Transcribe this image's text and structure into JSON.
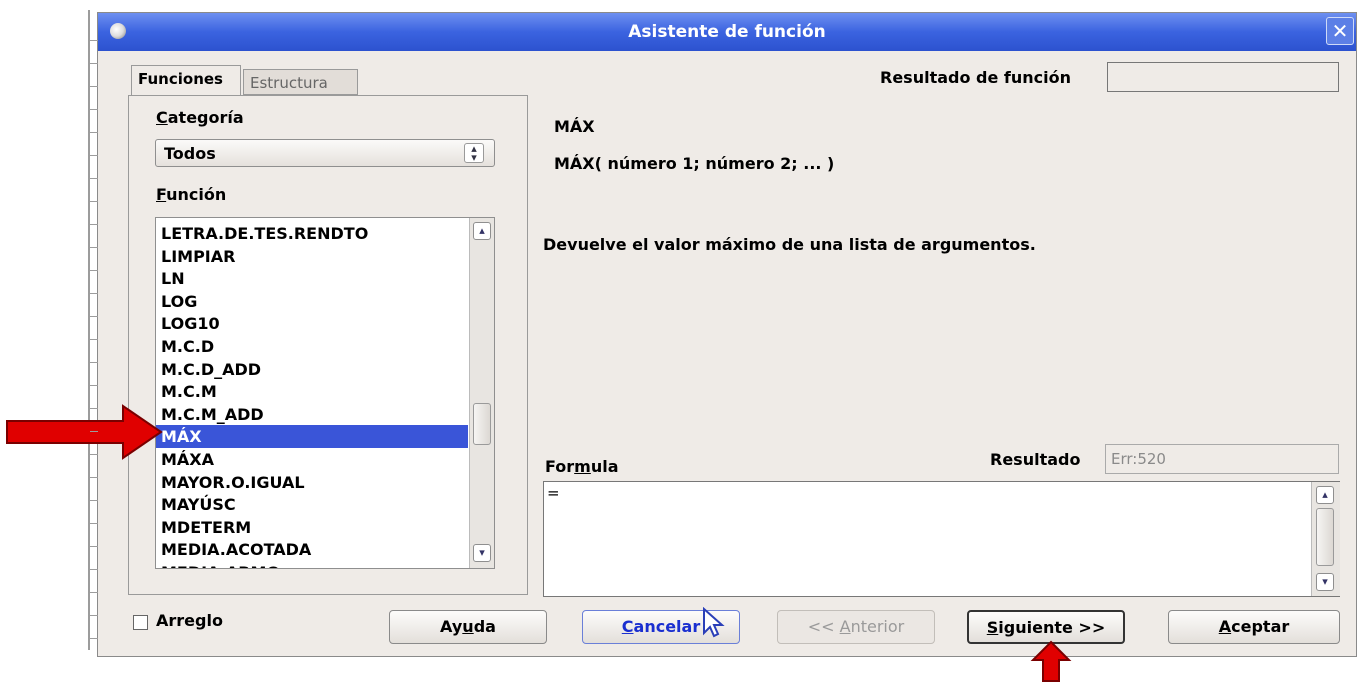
{
  "dialog": {
    "title": "Asistente de función",
    "close_glyph": "✕"
  },
  "tabs": {
    "funciones": "Funciones",
    "estructura": "Estructura"
  },
  "left": {
    "categoria_label": "Categoría",
    "categoria_value": "Todos",
    "funcion_label": "Función",
    "functions": [
      "LETRA.DE.TES.RENDTO",
      "LIMPIAR",
      "LN",
      "LOG",
      "LOG10",
      "M.C.D",
      "M.C.D_ADD",
      "M.C.M",
      "M.C.M_ADD",
      "MÁX",
      "MÁXA",
      "MAYOR.O.IGUAL",
      "MAYÚSC",
      "MDETERM",
      "MEDIA.ACOTADA",
      "MEDIA.ARMO"
    ],
    "selected_index": 9,
    "arreglo_label": "Arreglo",
    "arreglo_checked": false
  },
  "right": {
    "resultado_funcion_label": "Resultado de función",
    "resultado_funcion_value": "",
    "func_name": "MÁX",
    "func_syntax": "MÁX( número 1; número 2; ...  )",
    "func_description": "Devuelve el valor máximo de una lista de argumentos.",
    "formula_label": "Formula",
    "resultado_label": "Resultado",
    "resultado_value": "Err:520",
    "formula_text": "="
  },
  "buttons": {
    "ayuda": "Ayuda",
    "cancelar": "Cancelar",
    "anterior": "<< Anterior",
    "siguiente": "Siguiente >>",
    "aceptar": "Aceptar"
  },
  "icons": {
    "up": "▲",
    "down": "▼",
    "spin": "⌃⌄"
  },
  "colors": {
    "titlebar": "#3b63e0",
    "selection": "#3a55d8",
    "annotation_arrow": "#e00000"
  }
}
